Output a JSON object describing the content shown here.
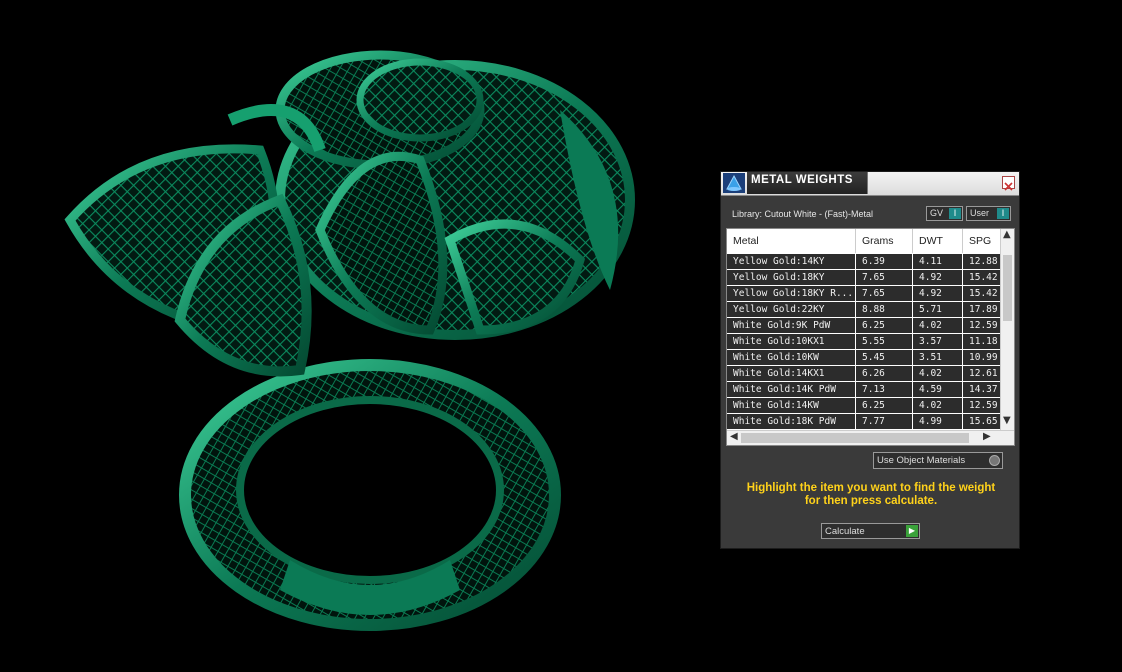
{
  "colors": {
    "ring": "#0b7a55",
    "ring_highlight": "#35c48f",
    "accent": "#ffd21a"
  },
  "panel": {
    "title": "METAL WEIGHTS",
    "library": "Library: Cutout White - (Fast)-Metal",
    "gv_label": "GV",
    "user_label": "User",
    "columns": [
      "Metal",
      "Grams",
      "DWT",
      "SPG"
    ],
    "rows": [
      [
        "Yellow Gold:14KY",
        "6.39",
        "4.11",
        "12.88"
      ],
      [
        "Yellow Gold:18KY",
        "7.65",
        "4.92",
        "15.42"
      ],
      [
        "Yellow Gold:18KY R...",
        "7.65",
        "4.92",
        "15.42"
      ],
      [
        "Yellow Gold:22KY",
        "8.88",
        "5.71",
        "17.89"
      ],
      [
        "White Gold:9K PdW",
        "6.25",
        "4.02",
        "12.59"
      ],
      [
        "White Gold:10KX1",
        "5.55",
        "3.57",
        "11.18"
      ],
      [
        "White Gold:10KW",
        "5.45",
        "3.51",
        "10.99"
      ],
      [
        "White Gold:14KX1",
        "6.26",
        "4.02",
        "12.61"
      ],
      [
        "White Gold:14K PdW",
        "7.13",
        "4.59",
        "14.37"
      ],
      [
        "White Gold:14KW",
        "6.25",
        "4.02",
        "12.59"
      ],
      [
        "White Gold:18K PdW",
        "7.77",
        "4.99",
        "15.65"
      ]
    ],
    "use_object_materials": "Use Object Materials",
    "hint_line1": "Highlight the item you want to find the weight",
    "hint_line2": "for then press calculate.",
    "calculate_label": "Calculate"
  }
}
